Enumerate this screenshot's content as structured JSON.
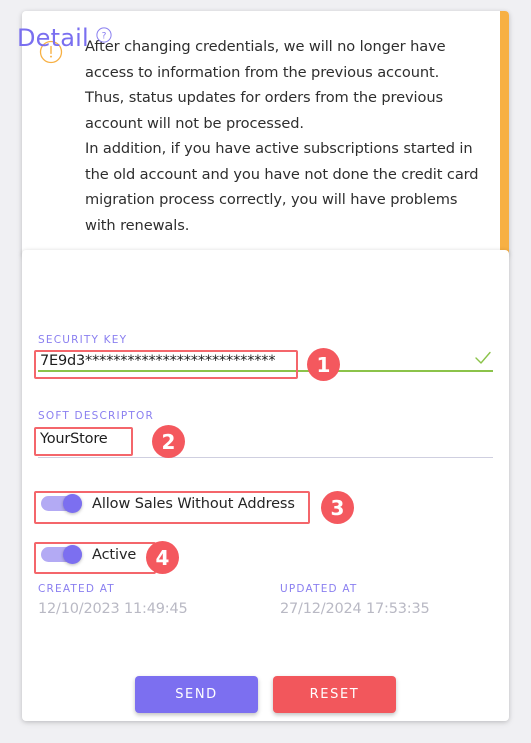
{
  "warning": {
    "icon": "alert-circle-icon",
    "accent_color": "#f7b043",
    "message": "After changing credentials, we will no longer have access to information from the previous account.\nThus, status updates for orders from the previous account will not be processed.\nIn addition, if you have active subscriptions started in the old account and you have not done the credit card migration process correctly, you will have problems with renewals."
  },
  "detail": {
    "title": "Detail",
    "help_icon": "help-circle-icon",
    "accent_color": "#7a6ff0",
    "security_key": {
      "label": "SECURITY KEY",
      "value": "7E9d3***************************",
      "valid": true,
      "valid_icon": "check-icon",
      "valid_color": "#8bc34a"
    },
    "soft_descriptor": {
      "label": "SOFT DESCRIPTOR",
      "value": "YourStore"
    },
    "allow_sales_without_address": {
      "label": "Allow Sales Without Address",
      "state": "on"
    },
    "active": {
      "label": "Active",
      "state": "on"
    },
    "created_at": {
      "label": "CREATED AT",
      "value": "12/10/2023 11:49:45"
    },
    "updated_at": {
      "label": "UPDATED AT",
      "value": "27/12/2024 17:53:35"
    },
    "buttons": {
      "send": "SEND",
      "reset": "RESET"
    }
  },
  "annotations": {
    "color": "#f4585e",
    "markers": [
      "1",
      "2",
      "3",
      "4"
    ]
  }
}
